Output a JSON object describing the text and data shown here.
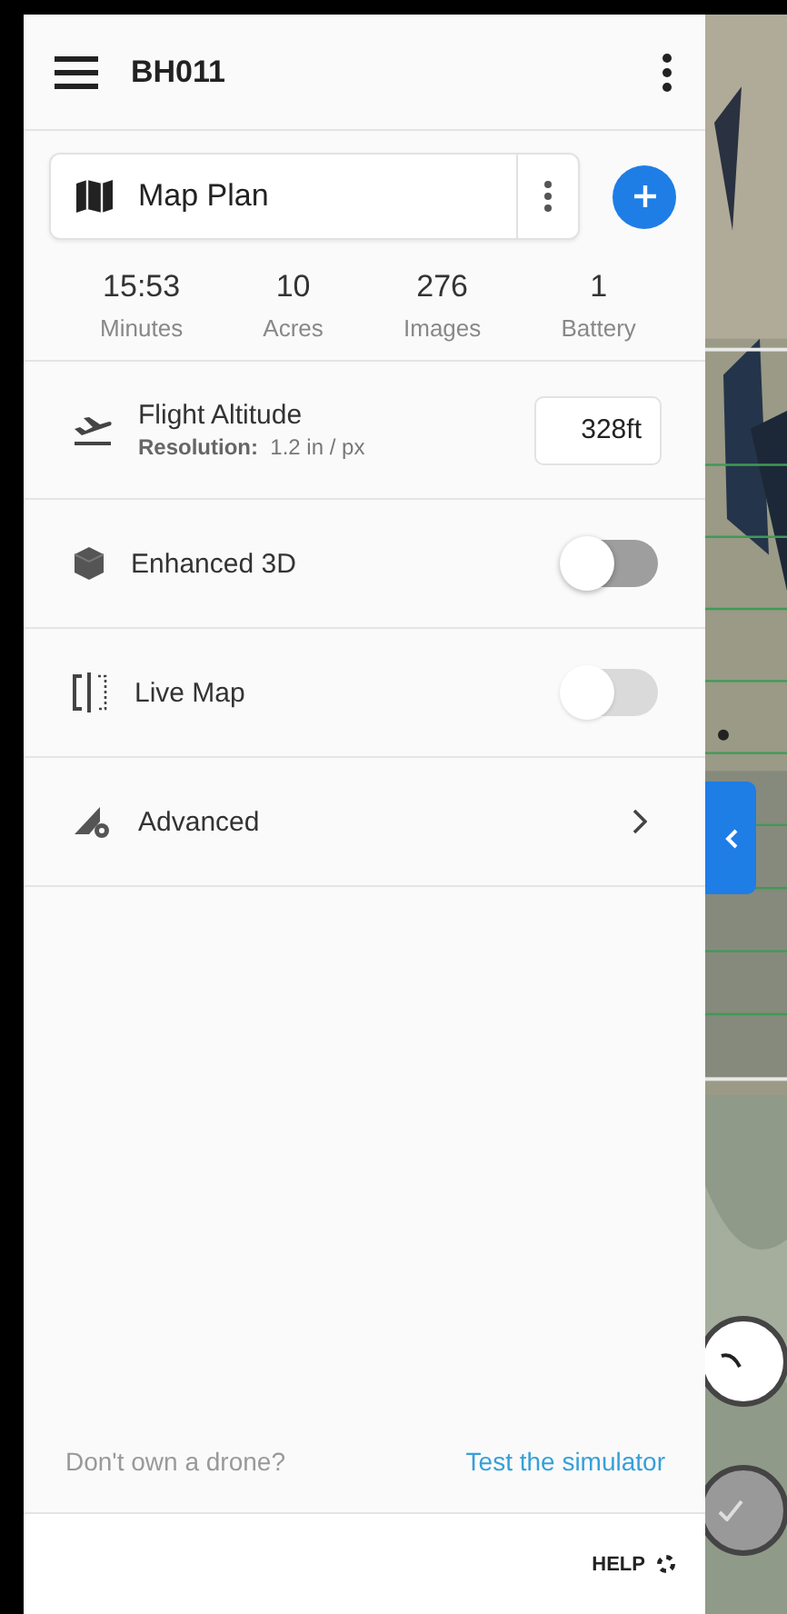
{
  "header": {
    "title": "BH011"
  },
  "plan": {
    "name": "Map Plan"
  },
  "stats": [
    {
      "value": "15:53",
      "label": "Minutes"
    },
    {
      "value": "10",
      "label": "Acres"
    },
    {
      "value": "276",
      "label": "Images"
    },
    {
      "value": "1",
      "label": "Battery"
    }
  ],
  "settings": [
    {
      "kind": "input",
      "label": "Flight Altitude",
      "detail_label": "Resolution:",
      "detail_value": "1.2 in / px",
      "value": "328ft"
    },
    {
      "kind": "toggle",
      "label": "Enhanced 3D",
      "on": false,
      "disabled": false
    },
    {
      "kind": "toggle",
      "label": "Live Map",
      "on": false,
      "disabled": true
    },
    {
      "kind": "link",
      "label": "Advanced"
    }
  ],
  "footer": {
    "prompt": "Don't own a drone?",
    "link": "Test the simulator",
    "help": "HELP"
  }
}
